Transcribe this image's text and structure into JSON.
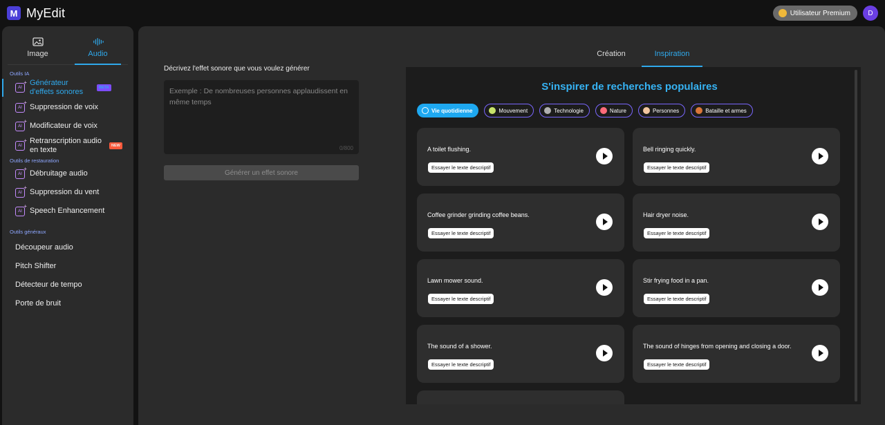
{
  "app": {
    "logo_letter": "M",
    "name": "MyEdit",
    "premium_label": "Utilisateur Premium",
    "avatar_letter": "D"
  },
  "sidebar": {
    "mode_tabs": [
      {
        "label": "Image",
        "icon": "image-icon"
      },
      {
        "label": "Audio",
        "icon": "audio-wave-icon",
        "active": true
      }
    ],
    "sections": {
      "ai": "Outils IA",
      "restore": "Outils de restauration",
      "general": "Outils généraux"
    },
    "ai_items": [
      {
        "label": "Générateur d'effets sonores",
        "badge": "BETA",
        "active": true
      },
      {
        "label": "Suppression de voix"
      },
      {
        "label": "Modificateur de voix"
      },
      {
        "label": "Retranscription audio en texte",
        "badge": "NEW"
      }
    ],
    "restore_items": [
      {
        "label": "Débruitage audio"
      },
      {
        "label": "Suppression du vent"
      },
      {
        "label": "Speech Enhancement"
      }
    ],
    "general_items": [
      {
        "label": "Découpeur audio"
      },
      {
        "label": "Pitch Shifter"
      },
      {
        "label": "Détecteur de tempo"
      },
      {
        "label": "Porte de bruit"
      }
    ]
  },
  "form": {
    "label": "Décrivez l'effet sonore que vous voulez générer",
    "placeholder": "Exemple : De nombreuses personnes applaudissent en même temps",
    "value": "",
    "char_count": "0/800",
    "generate_label": "Générer un effet sonore"
  },
  "tabs": [
    {
      "label": "Création"
    },
    {
      "label": "Inspiration",
      "active": true
    }
  ],
  "inspiration": {
    "title": "S'inspirer de recherches populaires",
    "chips": [
      {
        "label": "Vie quotidienne",
        "active": true,
        "color": "#ffffff"
      },
      {
        "label": "Mouvement",
        "color": "#c7e36a"
      },
      {
        "label": "Technologie",
        "color": "#b0b0b0"
      },
      {
        "label": "Nature",
        "color": "#ff6b7a"
      },
      {
        "label": "Personnes",
        "color": "#f2c6a0"
      },
      {
        "label": "Bataille et armes",
        "color": "#d9763a"
      }
    ],
    "try_label": "Essayer le texte descriptif",
    "cards": [
      {
        "text": "A toilet flushing."
      },
      {
        "text": "Bell ringing quickly."
      },
      {
        "text": "Coffee grinder grinding coffee beans."
      },
      {
        "text": "Hair dryer noise."
      },
      {
        "text": "Lawn mower sound."
      },
      {
        "text": "Stir frying food in a pan."
      },
      {
        "text": "The sound of a shower."
      },
      {
        "text": "The sound of hinges from opening and closing a door."
      }
    ]
  },
  "colors": {
    "accent": "#2fa9ec",
    "badge_beta": "#7d4dff",
    "badge_new": "#ff5a3c",
    "ai_icon": "#c58cff"
  }
}
